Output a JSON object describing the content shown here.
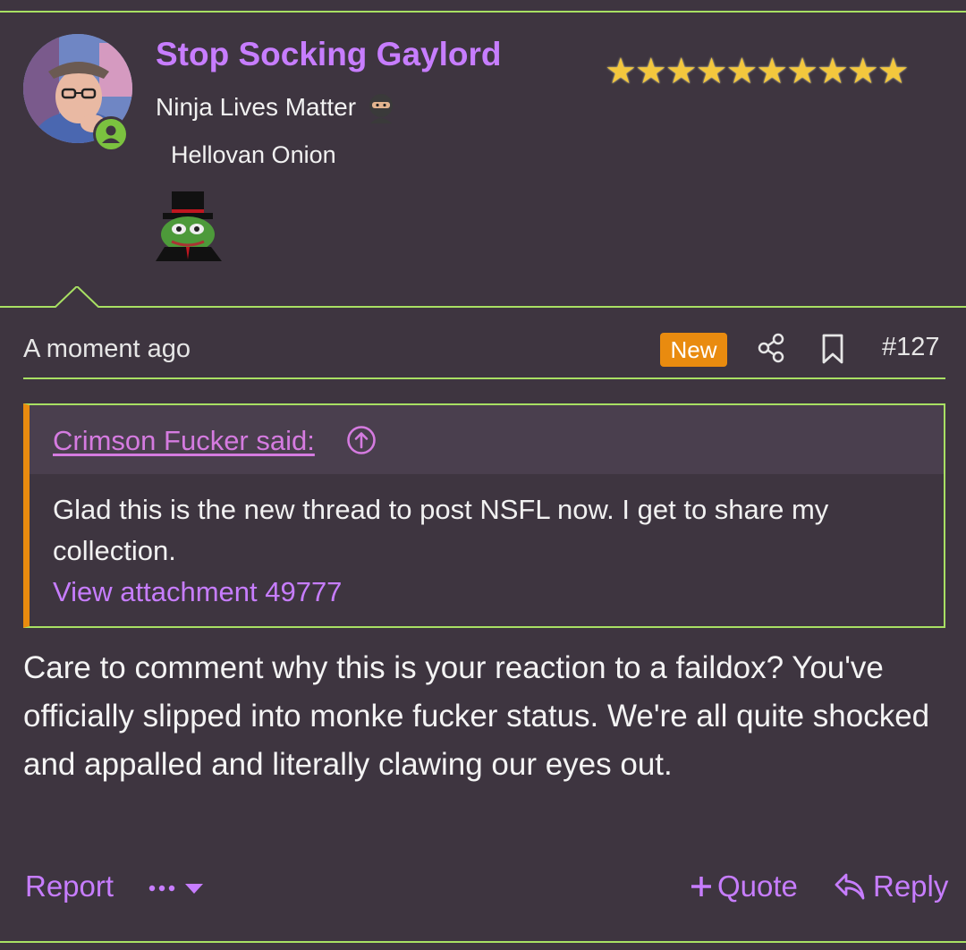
{
  "user": {
    "name": "Stop Socking Gaylord",
    "title": "Ninja Lives Matter",
    "banner": "Hellovan Onion",
    "stars": "★★★★★★★★★★"
  },
  "post": {
    "time": "A moment ago",
    "badge": "New",
    "number": "#127"
  },
  "quote": {
    "author": "Crimson Fucker said:",
    "text": "Glad this is the new thread to post NSFL now. I get to share my collection.",
    "attachment": "View attachment 49777"
  },
  "message": "Care to comment why this is your reaction to a faildox? You've officially slipped into monke fucker status. We're all quite shocked and appalled and literally clawing our eyes out.",
  "actions": {
    "report": "Report",
    "quote": "Quote",
    "reply": "Reply"
  },
  "colors": {
    "background": "#3e3540",
    "accent_green": "#a8e063",
    "link_purple": "#c77dff",
    "badge_orange": "#e98b0f",
    "star_gold": "#f3c73d"
  },
  "icons": {
    "online": "user-online-icon",
    "share": "share-icon",
    "bookmark": "bookmark-icon",
    "jump": "arrow-up-circle-icon",
    "more": "ellipsis-icon",
    "quote": "plus-icon",
    "reply": "reply-icon"
  }
}
